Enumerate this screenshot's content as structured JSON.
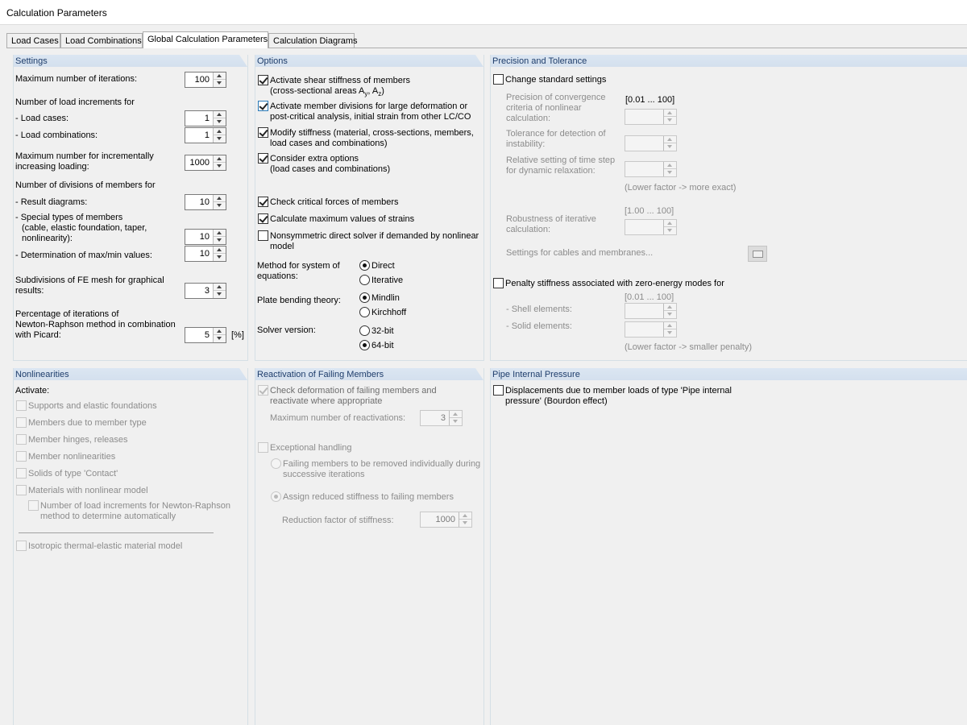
{
  "window": {
    "title": "Calculation Parameters"
  },
  "tabs": [
    "Load Cases",
    "Load Combinations",
    "Global Calculation Parameters",
    "Calculation Diagrams"
  ],
  "settings": {
    "header": "Settings",
    "max_iterations_label": "Maximum number of iterations:",
    "max_iterations": "100",
    "load_increments_label": "Number of load increments for",
    "load_cases_label": "- Load cases:",
    "load_cases": "1",
    "load_combinations_label": "- Load combinations:",
    "load_combinations": "1",
    "max_incremental_l1": "Maximum number for incrementally",
    "max_incremental_l2": "increasing loading:",
    "max_incremental": "1000",
    "divisions_label": "Number of divisions of members for",
    "result_diagrams_label": "- Result diagrams:",
    "result_diagrams": "10",
    "special_l1": "- Special types of members",
    "special_l2": "(cable, elastic foundation, taper,",
    "special_l3": "nonlinearity):",
    "special": "10",
    "maxmin_label": "- Determination of max/min values:",
    "maxmin": "10",
    "fe_l1": "Subdivisions of FE mesh for graphical",
    "fe_l2": "results:",
    "fe": "3",
    "pct_l1": "Percentage of iterations of",
    "pct_l2": "Newton-Raphson method in combination",
    "pct_l3": "with Picard:",
    "pct": "5",
    "pct_unit": "[%]"
  },
  "options": {
    "header": "Options",
    "shear_l1": "Activate shear stiffness of members",
    "shear_l2": "(cross-sectional areas A",
    "shear_y": "y",
    "shear_sep": ", A",
    "shear_z": "z",
    "shear_end": ")",
    "divisions_l1": "Activate member divisions for large deformation or",
    "divisions_l2": "post-critical analysis, initial strain from other LC/CO",
    "modify_l1": "Modify stiffness (material, cross-sections, members,",
    "modify_l2": "load cases and combinations)",
    "extra_l1": "Consider extra options",
    "extra_l2": "(load cases and combinations)",
    "critical": "Check critical forces of members",
    "strains": "Calculate maximum values of strains",
    "nonsym_l1": "Nonsymmetric direct solver if demanded by nonlinear",
    "nonsym_l2": "model",
    "method_l1": "Method for system of",
    "method_l2": "equations:",
    "direct": "Direct",
    "iterative": "Iterative",
    "plate_label": "Plate bending theory:",
    "mindlin": "Mindlin",
    "kirchhoff": "Kirchhoff",
    "solver_label": "Solver version:",
    "bit32": "32-bit",
    "bit64": "64-bit"
  },
  "precision": {
    "header": "Precision and Tolerance",
    "change_std": "Change standard settings",
    "conv_l1": "Precision of convergence",
    "conv_l2": "criteria of nonlinear",
    "conv_l3": "calculation:",
    "range1": "[0.01 ... 100]",
    "instab_l1": "Tolerance for detection of",
    "instab_l2": "instability:",
    "timestep_l1": "Relative setting of time step",
    "timestep_l2": "for dynamic relaxation:",
    "lower_factor": "(Lower factor -> more exact)",
    "range2": "[1.00 ... 100]",
    "robust_l1": "Robustness of iterative",
    "robust_l2": "calculation:",
    "cables": "Settings for cables and membranes...",
    "penalty": "Penalty stiffness associated with zero-energy modes for",
    "range3": "[0.01 ... 100]",
    "shell": "- Shell elements:",
    "solid": "- Solid elements:",
    "lower_penalty": "(Lower factor -> smaller penalty)"
  },
  "nonlinearities": {
    "header": "Nonlinearities",
    "activate": "Activate:",
    "supports": "Supports and elastic foundations",
    "members_type": "Members due to member type",
    "hinges": "Member hinges, releases",
    "member_nl": "Member nonlinearities",
    "solids": "Solids of type 'Contact'",
    "materials": "Materials with nonlinear model",
    "nr_l1": "Number of load increments for Newton-Raphson",
    "nr_l2": "method to determine automatically",
    "isotropic": "Isotropic thermal-elastic material model"
  },
  "reactivation": {
    "header": "Reactivation of Failing Members",
    "check_l1": "Check deformation of failing members and",
    "check_l2": "reactivate where appropriate",
    "max_react_label": "Maximum number of reactivations:",
    "max_react": "3",
    "exceptional": "Exceptional handling",
    "fail_l1": "Failing members to be removed individually during",
    "fail_l2": "successive iterations",
    "assign": "Assign reduced stiffness to failing members",
    "reduction_label": "Reduction factor of stiffness:",
    "reduction": "1000"
  },
  "pipe": {
    "header": "Pipe Internal Pressure",
    "disp_l1": "Displacements due to member loads of type 'Pipe internal",
    "disp_l2": "pressure' (Bourdon effect)"
  }
}
